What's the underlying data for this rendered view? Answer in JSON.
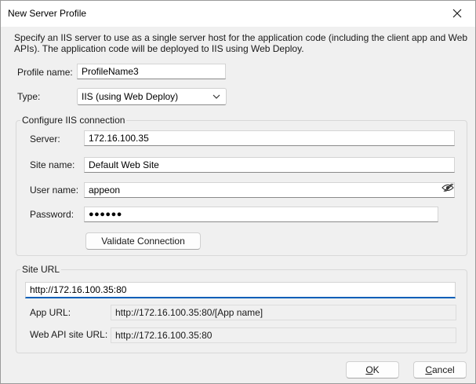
{
  "window": {
    "title": "New Server Profile"
  },
  "description": "Specify an IIS server to use as a single server host for the application code (including the client app and Web APIs). The application code will be deployed to IIS using Web Deploy.",
  "profile": {
    "name_label": "Profile name:",
    "name_value": "ProfileName3",
    "type_label": "Type:",
    "type_value": "IIS (using Web Deploy)"
  },
  "iis_connection": {
    "group_title": "Configure IIS connection",
    "server_label": "Server:",
    "server_value": "172.16.100.35",
    "site_name_label": "Site name:",
    "site_name_value": "Default Web Site",
    "user_name_label": "User name:",
    "user_name_value": "appeon",
    "password_label": "Password:",
    "password_mask": "●●●●●●",
    "validate_label": "Validate Connection"
  },
  "site_url": {
    "group_title": "Site URL",
    "url_value": "http://172.16.100.35:80",
    "app_url_label": "App URL:",
    "app_url_value": "http://172.16.100.35:80/[App name]",
    "web_api_label": "Web API site URL:",
    "web_api_value": "http://172.16.100.35:80"
  },
  "buttons": {
    "ok_first": "O",
    "ok_rest": "K",
    "cancel_first": "C",
    "cancel_rest": "ancel"
  },
  "icons": {
    "close": "close-icon",
    "dropdown": "chevron-down-icon",
    "reveal_password": "eye-slash-icon"
  }
}
